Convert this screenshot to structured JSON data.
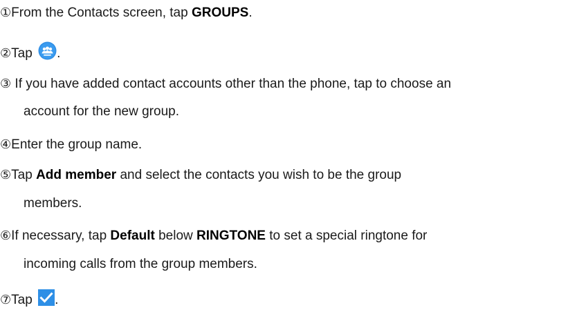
{
  "steps": [
    {
      "num": "①",
      "a": "From the Contacts screen, tap ",
      "b1": "GROUPS",
      "c": "."
    },
    {
      "num": "②",
      "a": "Tap ",
      "icon": "add-group-icon",
      "c": "."
    },
    {
      "num": "③",
      "a": " If you have added contact accounts other than the phone, tap to choose an",
      "cont": "account for the new group."
    },
    {
      "num": "④",
      "a": "Enter the group name."
    },
    {
      "num": "⑤",
      "a": "Tap ",
      "b1": "Add member",
      "c": " and select the contacts you wish to be the group",
      "cont": "members."
    },
    {
      "num": "⑥",
      "a": "If necessary, tap ",
      "b1": "Default",
      "mid": " below ",
      "b2": "RINGTONE",
      "c": " to set a special ringtone for",
      "cont": "incoming calls from the group members."
    },
    {
      "num": "⑦",
      "a": "Tap ",
      "icon": "checkmark-icon",
      "c": "."
    }
  ],
  "colors": {
    "group_icon_bg": "#2f8ee5",
    "check_icon_bg": "#2e8fe6"
  }
}
